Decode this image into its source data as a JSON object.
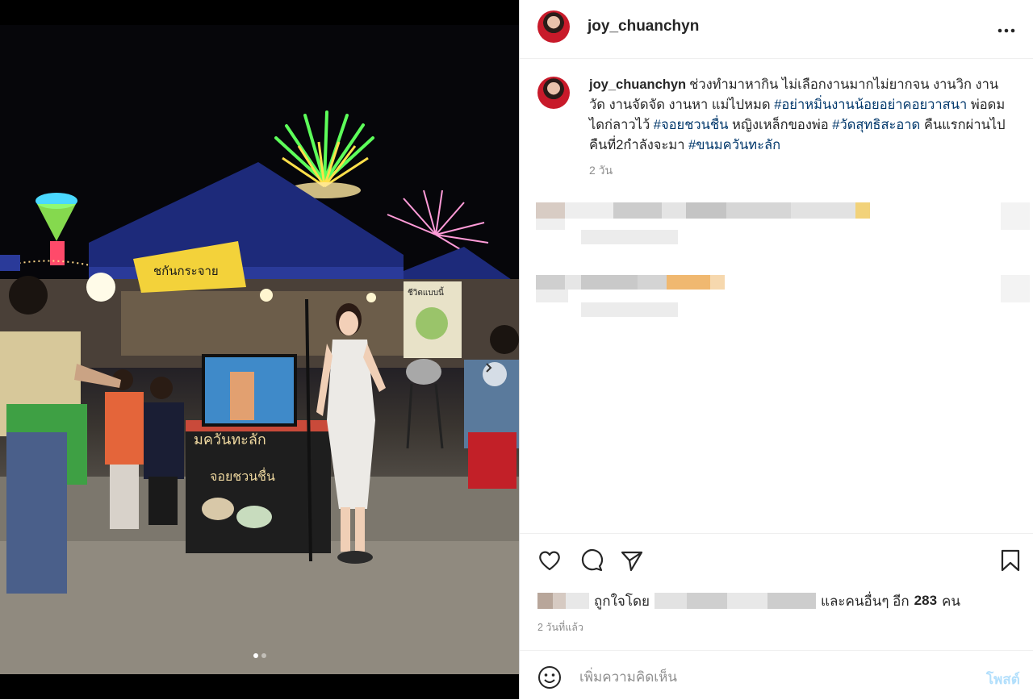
{
  "post": {
    "username": "joy_chuanchyn",
    "caption_text_1": "ช่วงทำมาหากิน ไม่เลือกงานมากไม่ยากจน งานวิก งานวัด งานจัดจัด งานหา แม่ไปหมด ",
    "hashtag_1": "#อย่าหมิ่นงานน้อยอย่าคอยวาสนา",
    "caption_text_2": " พ่อดมไดก่ลาวไว้ ",
    "hashtag_2": "#จอยชวนชื่น",
    "caption_text_3": " หญิงเหล็กของพ่อ ",
    "hashtag_3": "#วัดสุทธิสะอาด",
    "caption_text_4": " คืนแรกผ่านไป คืนที่2กำลังจะมา ",
    "hashtag_4": "#ขนมควันทะลัก",
    "caption_time": "2 วัน",
    "liked_by_label": "ถูกใจโดย",
    "others_label": "และคนอื่นๆ อีก",
    "likes_count": "283",
    "likes_unit": "คน",
    "post_date": "2 วันที่แล้ว",
    "comment_placeholder": "เพิ่มความคิดเห็น",
    "post_button": "โพสต์"
  },
  "media": {
    "photo_signs": {
      "banner_left": "ชกันกระจาย",
      "stall_front": "มควันทะลัก",
      "stall_name": "จอยชวนชื่น",
      "poster": "ชีวิตแบบนี้"
    },
    "carousel_total": 2,
    "carousel_active": 1
  },
  "icons": {
    "more": "more-horizontal-icon",
    "next": "chevron-right-icon",
    "like": "heart-icon",
    "comment": "comment-bubble-icon",
    "share": "paper-plane-icon",
    "save": "bookmark-icon",
    "emoji": "smiley-icon"
  },
  "colors": {
    "hashtag": "#00376b",
    "post_button_disabled": "#b2dffc",
    "muted": "#8e8e8e"
  }
}
